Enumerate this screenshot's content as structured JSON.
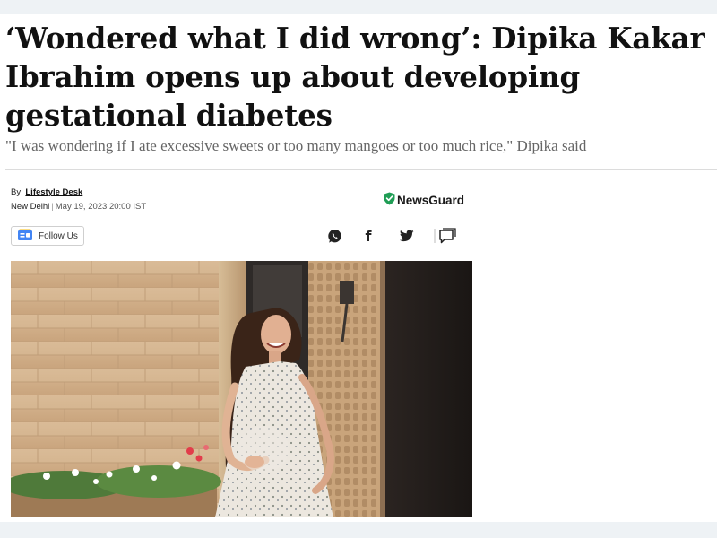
{
  "article": {
    "headline": "‘Wondered what I did wrong’: Dipika Kakar Ibrahim opens up about developing gestational diabetes",
    "subhead": "\"I was wondering if I ate excessive sweets or too many mangoes or too much rice,\" Dipika said",
    "byline_prefix": "By:",
    "author": "Lifestyle Desk",
    "location": "New Delhi",
    "date": "May 19, 2023 20:00 IST"
  },
  "newsguard": {
    "label": "NewsGuard",
    "icon": "shield-check-icon",
    "color": "#1f9d55"
  },
  "follow": {
    "label": "Follow Us",
    "icon": "google-news-icon"
  },
  "share": {
    "icons": [
      "whatsapp-icon",
      "facebook-icon",
      "twitter-icon",
      "comment-icon"
    ],
    "facebook_glyph": "f"
  },
  "image": {
    "alt": "Dipika Kakar Ibrahim"
  },
  "colors": {
    "background": "#eef2f5",
    "headline": "#111111",
    "subhead": "#666666",
    "newsguard_green": "#1f9d55"
  }
}
